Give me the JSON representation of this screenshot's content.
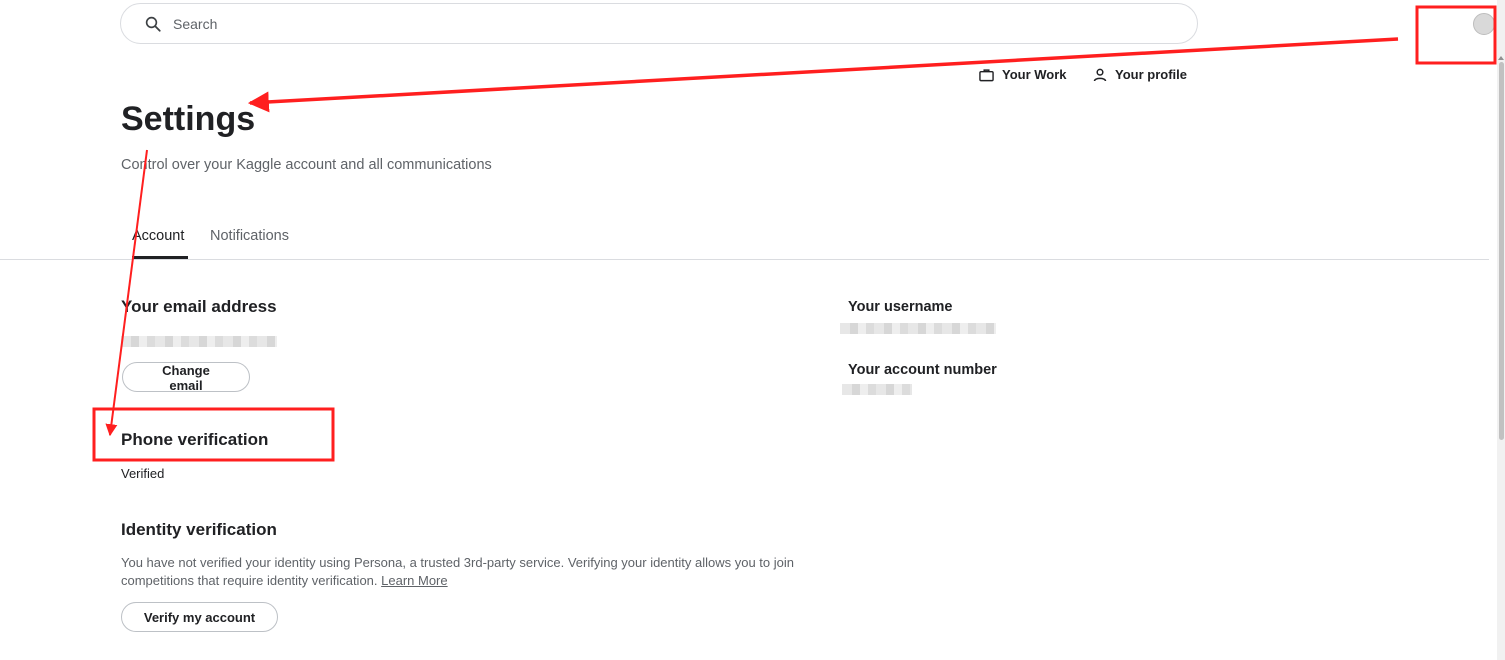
{
  "search": {
    "placeholder": "Search"
  },
  "top_nav": {
    "your_work": "Your Work",
    "your_profile": "Your profile"
  },
  "header": {
    "title": "Settings",
    "subtitle": "Control over your Kaggle account and all communications"
  },
  "tabs": [
    {
      "label": "Account",
      "active": true
    },
    {
      "label": "Notifications",
      "active": false
    }
  ],
  "email_section": {
    "heading": "Your email address",
    "change_button": "Change email"
  },
  "phone_section": {
    "heading": "Phone verification",
    "status": "Verified"
  },
  "identity_section": {
    "heading": "Identity verification",
    "description": "You have not verified your identity using Persona, a trusted 3rd-party service. Verifying your identity allows you to join competitions that require identity verification.",
    "learn_more": "Learn More",
    "verify_button": "Verify my account"
  },
  "right_column": {
    "username_label": "Your username",
    "account_number_label": "Your account number"
  },
  "annotation_colors": {
    "highlight": "#ff1f1f"
  }
}
